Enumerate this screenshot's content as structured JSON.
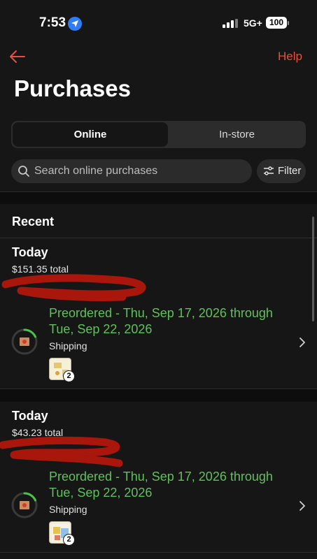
{
  "status_bar": {
    "time": "7:53",
    "network": "5G+",
    "battery": "100"
  },
  "nav": {
    "back_icon": "back-arrow-icon",
    "help_label": "Help"
  },
  "page": {
    "title": "Purchases"
  },
  "tabs": [
    {
      "label": "Online",
      "selected": true
    },
    {
      "label": "In-store",
      "selected": false
    }
  ],
  "search": {
    "placeholder": "Search online purchases",
    "value": ""
  },
  "filter": {
    "label": "Filter"
  },
  "section": {
    "label": "Recent"
  },
  "orders": [
    {
      "day": "Today",
      "total": "$151.35 total",
      "status": "Preordered - Thu, Sep 17, 2026 through Tue, Sep 22, 2026",
      "fulfillment": "Shipping",
      "item_count": "2"
    },
    {
      "day": "Today",
      "total": "$43.23 total",
      "status": "Preordered - Thu, Sep 17, 2026 through Tue, Sep 22, 2026",
      "fulfillment": "Shipping",
      "item_count": "2"
    }
  ],
  "colors": {
    "accent": "#e8503c",
    "status_green": "#5fc15b",
    "background": "#161616",
    "redaction": "#a8160c"
  }
}
